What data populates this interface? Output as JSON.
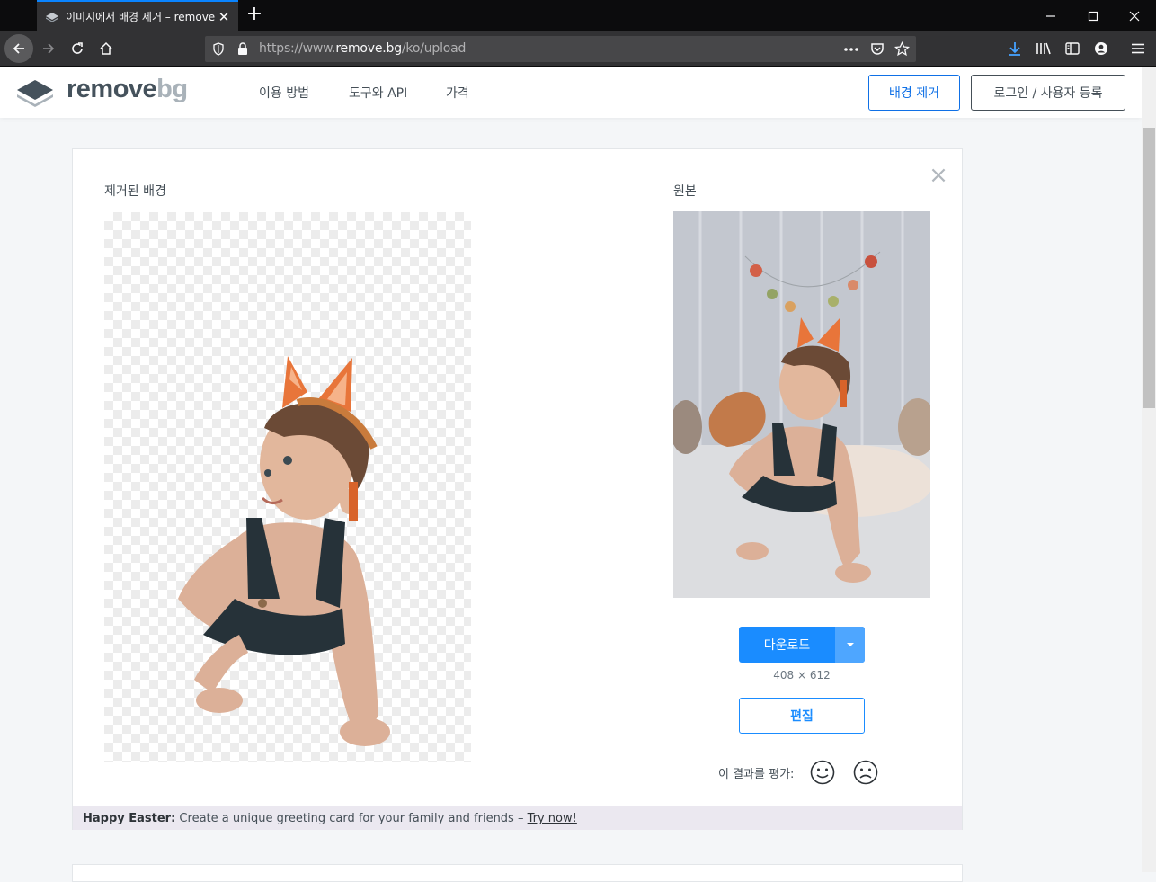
{
  "browser": {
    "tab_title": "이미지에서 배경 제거 – remove",
    "url_prefix": "https://www.",
    "url_host": "remove.bg",
    "url_path": "/ko/upload"
  },
  "header": {
    "logo_main": "remove",
    "logo_accent": "bg",
    "nav": [
      "이용 방법",
      "도구와 API",
      "가격"
    ],
    "cta_label": "배경 제거",
    "login_label": "로그인 / 사용자 등록"
  },
  "result": {
    "removed_title": "제거된 배경",
    "original_title": "원본",
    "download_label": "다운로드",
    "dimensions": "408 × 612",
    "edit_label": "편집",
    "rate_label": "이 결과를 평가:"
  },
  "banner": {
    "bold": "Happy Easter:",
    "text": " Create a unique greeting card for your family and friends – ",
    "link": "Try now!"
  },
  "colors": {
    "accent": "#1a8cff",
    "brand_dark": "#45525c"
  }
}
